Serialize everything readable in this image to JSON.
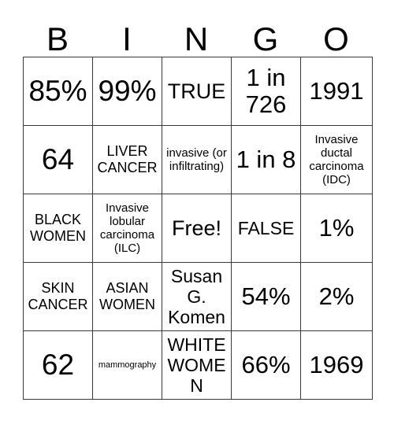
{
  "card": {
    "header": {
      "letters": [
        "B",
        "I",
        "N",
        "G",
        "O"
      ]
    },
    "rows": [
      [
        {
          "text": "85%",
          "size": "fs-xl"
        },
        {
          "text": "99%",
          "size": "fs-xl"
        },
        {
          "text": "TRUE",
          "size": "fs-md"
        },
        {
          "text": "1 in 726",
          "size": "fs-lg"
        },
        {
          "text": "1991",
          "size": "fs-lg"
        }
      ],
      [
        {
          "text": "64",
          "size": "fs-xl"
        },
        {
          "text": "LIVER CANCER",
          "size": "fs-xs"
        },
        {
          "text": "invasive (or infiltrating)",
          "size": "fs-xxs"
        },
        {
          "text": "1 in 8",
          "size": "fs-lg"
        },
        {
          "text": "Invasive ductal carcinoma (IDC)",
          "size": "fs-xxs"
        }
      ],
      [
        {
          "text": "BLACK WOMEN",
          "size": "fs-xs"
        },
        {
          "text": "Invasive lobular carcinoma (ILC)",
          "size": "fs-xxs"
        },
        {
          "text": "Free!",
          "size": "fs-md"
        },
        {
          "text": "FALSE",
          "size": "fs-sm"
        },
        {
          "text": "1%",
          "size": "fs-lg"
        }
      ],
      [
        {
          "text": "SKIN CANCER",
          "size": "fs-xs"
        },
        {
          "text": "ASIAN WOMEN",
          "size": "fs-xs"
        },
        {
          "text": "Susan G. Komen",
          "size": "fs-sm"
        },
        {
          "text": "54%",
          "size": "fs-lg"
        },
        {
          "text": "2%",
          "size": "fs-lg"
        }
      ],
      [
        {
          "text": "62",
          "size": "fs-xl"
        },
        {
          "text": "mammography",
          "size": "fs-tiny"
        },
        {
          "text": "WHITE WOMEN",
          "size": "fs-sm"
        },
        {
          "text": "66%",
          "size": "fs-lg"
        },
        {
          "text": "1969",
          "size": "fs-lg"
        }
      ]
    ]
  }
}
